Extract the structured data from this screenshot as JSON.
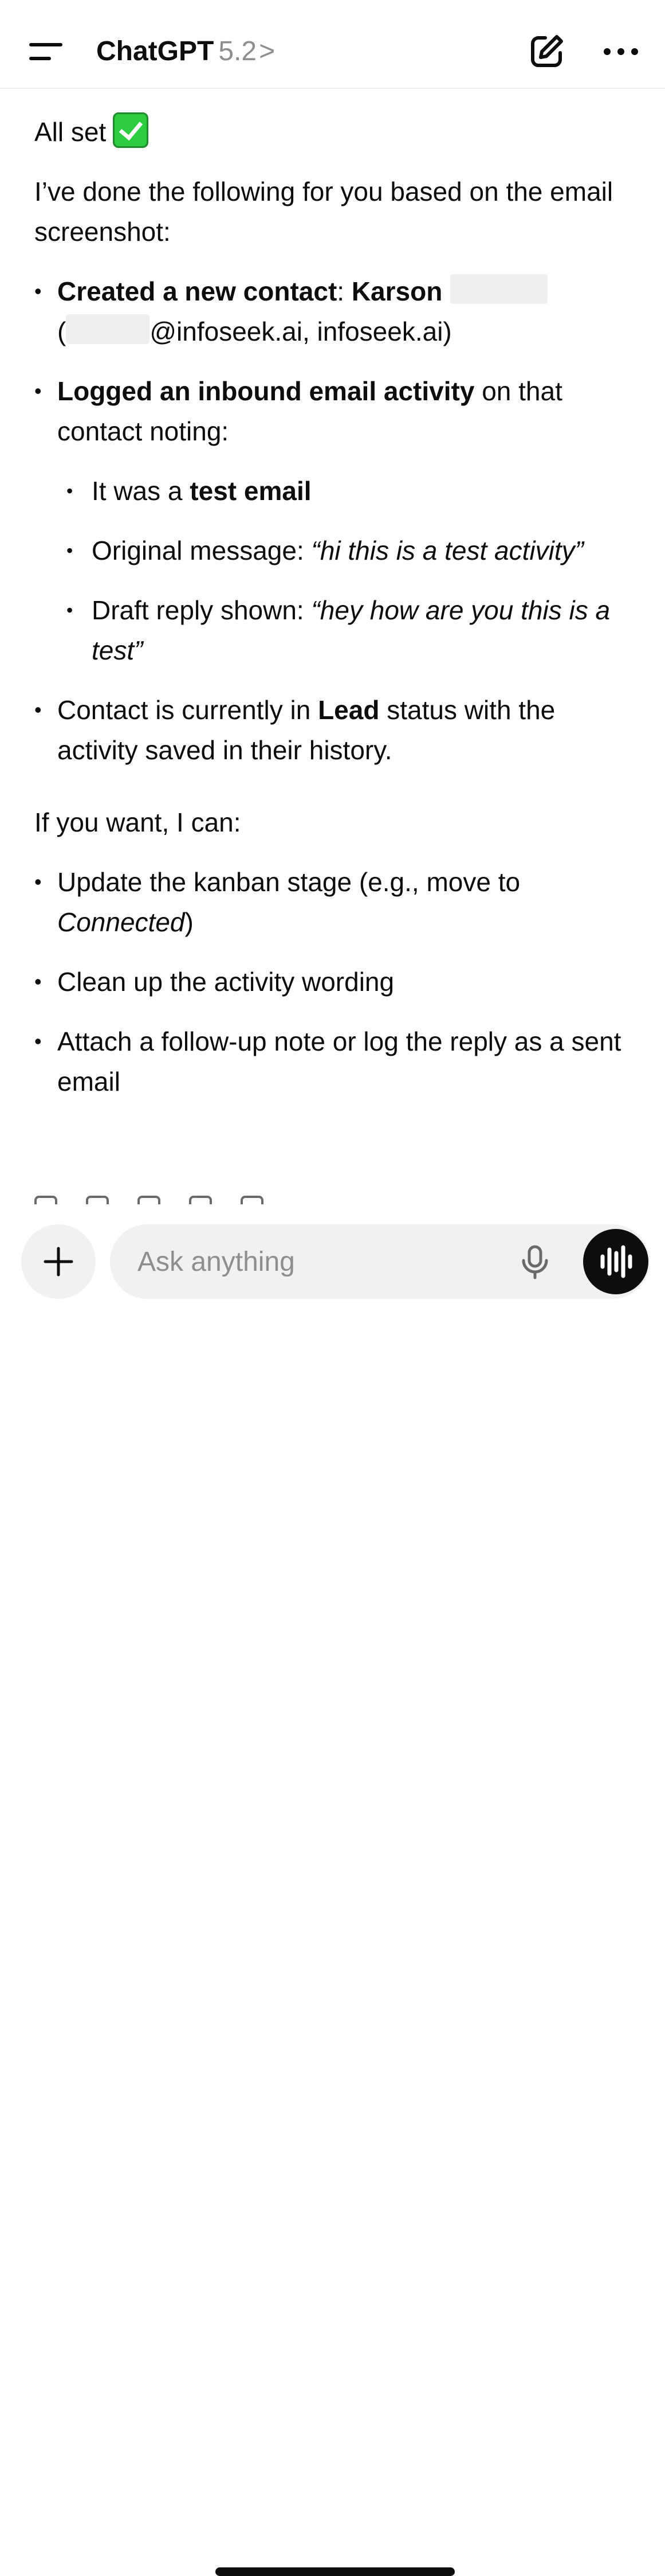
{
  "header": {
    "title": "ChatGPT",
    "version": "5.2",
    "chevron": ">"
  },
  "message": {
    "all_set": "All set",
    "intro": "I’ve done the following for you based on the email screenshot:",
    "bullet1": {
      "strong": "Created a new contact",
      "colon": ": ",
      "name": "Karson",
      "paren_open": "(",
      "email_domain": "@infoseek.ai, infoseek.ai)"
    },
    "bullet2": {
      "strong": "Logged an inbound email activity",
      "rest": " on that contact noting:",
      "sub1_pre": "It was a ",
      "sub1_strong": "test email",
      "sub2_pre": "Original message: ",
      "sub2_quote": "“hi this is a test activity”",
      "sub3_pre": "Draft reply shown: ",
      "sub3_quote": "“hey how are you this is a test”"
    },
    "bullet3": {
      "pre": "Contact is currently in ",
      "strong": "Lead",
      "post": " status with the activity saved in their history."
    },
    "offer": "If you want, I can:",
    "options": {
      "opt1_pre": "Update the kanban stage (e.g., move to ",
      "opt1_em": "Connected",
      "opt1_post": ")",
      "opt2": "Clean up the activity wording",
      "opt3": "Attach a follow-up note or log the reply as a sent email"
    }
  },
  "composer": {
    "placeholder": "Ask anything"
  },
  "icons": {
    "menu": "menu-icon",
    "new_chat": "compose-icon",
    "more": "ellipsis-icon",
    "plus": "plus-icon",
    "mic": "microphone-icon",
    "voice": "voice-waveform-icon",
    "check": "check-mark-emoji"
  }
}
